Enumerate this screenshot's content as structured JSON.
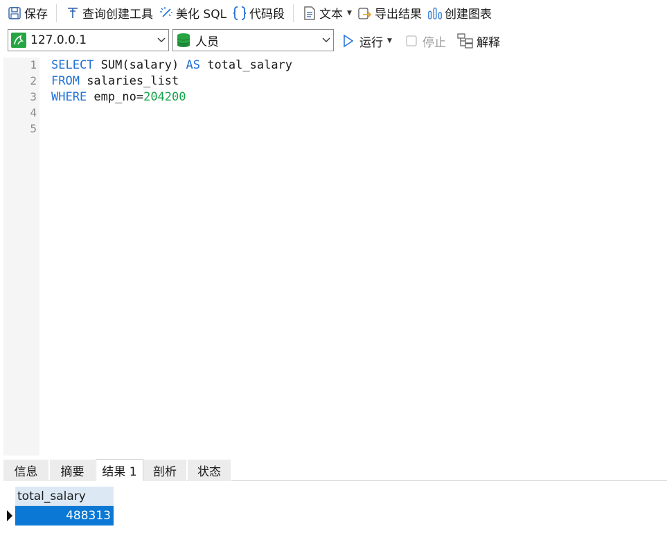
{
  "toolbar": {
    "save": {
      "label": "保存",
      "icon": "save-icon"
    },
    "query_builder": {
      "label": "查询创建工具",
      "icon": "query-builder-icon"
    },
    "beautify_sql": {
      "label": "美化 SQL",
      "icon": "magic-wand-icon"
    },
    "code_snippet": {
      "label": "代码段",
      "icon": "braces-icon"
    },
    "text": {
      "label": "文本",
      "icon": "document-icon"
    },
    "export_result": {
      "label": "导出结果",
      "icon": "export-icon"
    },
    "create_chart": {
      "label": "创建图表",
      "icon": "chart-icon"
    }
  },
  "connection": {
    "value": "127.0.0.1",
    "icon": "mysql-connection-icon"
  },
  "database": {
    "value": "人员",
    "icon": "database-icon"
  },
  "run": {
    "label": "运行",
    "icon": "play-icon"
  },
  "stop": {
    "label": "停止",
    "icon": "stop-icon"
  },
  "explain": {
    "label": "解释",
    "icon": "explain-icon"
  },
  "editor": {
    "line_numbers": [
      "1",
      "2",
      "3",
      "4",
      "5"
    ],
    "lines": [
      {
        "kw1": "SELECT",
        "t1": " SUM(salary) ",
        "kw2": "AS",
        "t2": " total_salary"
      },
      {
        "kw1": "FROM",
        "t1": " salaries_list"
      },
      {
        "kw1": "WHERE",
        "t1": " emp_no=",
        "num": "204200"
      }
    ]
  },
  "tabs": [
    "信息",
    "摘要",
    "结果 1",
    "剖析",
    "状态"
  ],
  "active_tab": "结果 1",
  "results": {
    "columns": [
      "total_salary"
    ],
    "rows": [
      [
        "488313"
      ]
    ]
  },
  "colors": {
    "keyword": "#1f6fd6",
    "number": "#16a34a",
    "selected_cell": "#0a78d4",
    "header": "#dce9f5"
  }
}
